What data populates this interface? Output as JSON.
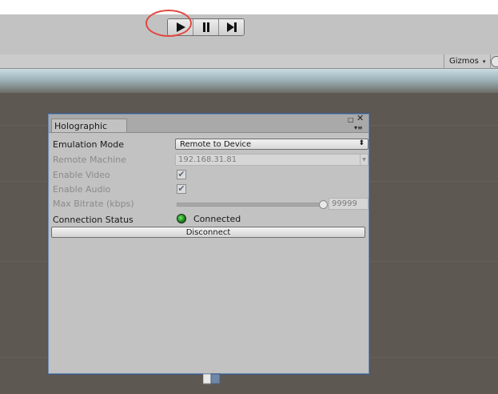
{
  "toolbar": {
    "play_icon": "play-icon",
    "pause_icon": "pause-icon",
    "step_icon": "step-icon"
  },
  "scene": {
    "gizmos_label": "Gizmos",
    "gizmos_arrow": "▾"
  },
  "panel": {
    "tab_title": "Holographic",
    "rows": {
      "emulation_mode": {
        "label": "Emulation Mode",
        "value": "Remote to Device"
      },
      "remote_machine": {
        "label": "Remote Machine",
        "value": "192.168.31.81"
      },
      "enable_video": {
        "label": "Enable Video",
        "checked": true
      },
      "enable_audio": {
        "label": "Enable Audio",
        "checked": true
      },
      "max_bitrate": {
        "label": "Max Bitrate (kbps)",
        "value": "99999",
        "slider_level": 1.0
      },
      "connection_status": {
        "label": "Connection Status",
        "value": "Connected"
      }
    },
    "disconnect_label": "Disconnect"
  },
  "colors": {
    "highlight_circle": "#e2463f",
    "status_connected": "#2fae29",
    "panel_border": "#6d8ab0"
  }
}
